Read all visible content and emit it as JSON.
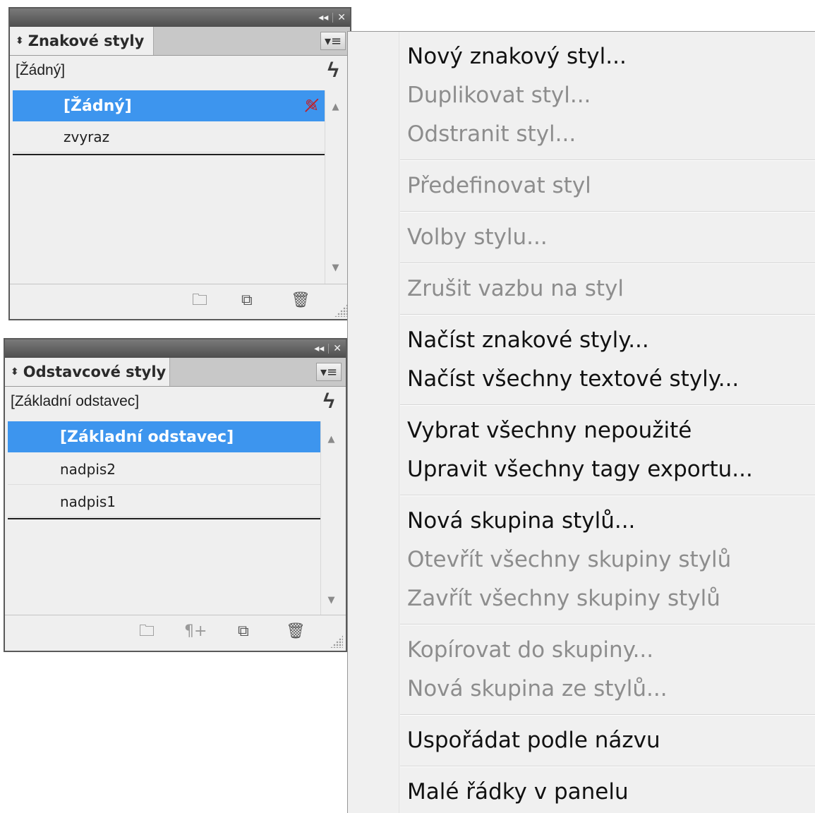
{
  "char_panel": {
    "tab_label": "Znakové styly",
    "current_style": "[Žádný]",
    "items": [
      {
        "label": "[Žádný]"
      },
      {
        "label": "zvyraz"
      }
    ]
  },
  "para_panel": {
    "tab_label": "Odstavcové styly",
    "current_style": "[Základní odstavec]",
    "items": [
      {
        "label": "[Základní odstavec]"
      },
      {
        "label": "nadpis2"
      },
      {
        "label": "nadpis1"
      }
    ]
  },
  "menu": {
    "items": [
      {
        "label": "Nový znakový styl...",
        "enabled": true
      },
      {
        "label": "Duplikovat styl...",
        "enabled": false
      },
      {
        "label": "Odstranit styl...",
        "enabled": false
      },
      {
        "label": "Předefinovat styl",
        "enabled": false
      },
      {
        "label": "Volby stylu...",
        "enabled": false
      },
      {
        "label": "Zrušit vazbu na styl",
        "enabled": false
      },
      {
        "label": "Načíst znakové styly...",
        "enabled": true
      },
      {
        "label": "Načíst všechny textové styly...",
        "enabled": true
      },
      {
        "label": "Vybrat všechny nepoužité",
        "enabled": true
      },
      {
        "label": "Upravit všechny tagy exportu...",
        "enabled": true
      },
      {
        "label": "Nová skupina stylů...",
        "enabled": true
      },
      {
        "label": "Otevřít všechny skupiny stylů",
        "enabled": false
      },
      {
        "label": "Zavřít všechny skupiny stylů",
        "enabled": false
      },
      {
        "label": "Kopírovat do skupiny...",
        "enabled": false
      },
      {
        "label": "Nová skupina ze stylů...",
        "enabled": false
      },
      {
        "label": "Uspořádat podle názvu",
        "enabled": true
      },
      {
        "label": "Malé řádky v panelu",
        "enabled": true
      }
    ]
  },
  "icons": {
    "collapse": "double-arrow-left-icon",
    "close": "close-icon",
    "panel_menu": "panel-menu-icon",
    "clear_overrides": "lightning-icon",
    "no_break": "pen-slash-icon",
    "new_group": "folder-icon",
    "new_style": "new-page-icon",
    "delete": "trash-icon",
    "paragraph_override": "pilcrow-plus-icon"
  },
  "colors": {
    "selection": "#3d95ee",
    "disabled_text": "#8d8d8d",
    "titlebar": "#5a5a5a"
  }
}
